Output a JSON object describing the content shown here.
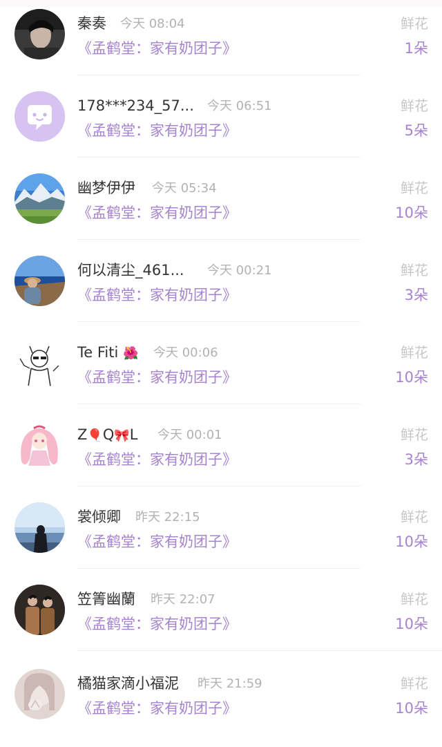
{
  "rows": [
    {
      "name": "秦奏",
      "time": "今天 08:04",
      "book": "《孟鹤堂：家有奶团子》",
      "gift": "鲜花",
      "count": "1朵",
      "avatar": "photo-portrait-dark"
    },
    {
      "name": "178***234_57...",
      "time": "今天 06:51",
      "book": "《孟鹤堂：家有奶团子》",
      "gift": "鲜花",
      "count": "5朵",
      "avatar": "purple-chat-icon"
    },
    {
      "name": "幽梦伊伊",
      "time": "今天 05:34",
      "book": "《孟鹤堂：家有奶团子》",
      "gift": "鲜花",
      "count": "10朵",
      "avatar": "mountain-landscape"
    },
    {
      "name": "何以清尘_461...",
      "time": "今天 00:21",
      "book": "《孟鹤堂：家有奶团子》",
      "gift": "鲜花",
      "count": "3朵",
      "avatar": "seaside-person"
    },
    {
      "name": "Te Fiti",
      "name_emoji": "🌺",
      "time": "今天 00:06",
      "book": "《孟鹤堂：家有奶团子》",
      "gift": "鲜花",
      "count": "10朵",
      "avatar": "sketch-character"
    },
    {
      "name": "Z",
      "name_emoji": "🎈",
      "name_mid": "Q",
      "name_emoji2": "🎀",
      "name_end": "L",
      "time": "今天 00:01",
      "book": "《孟鹤堂：家有奶团子》",
      "gift": "鲜花",
      "count": "3朵",
      "avatar": "anime-pink-girl"
    },
    {
      "name": "裳倾卿",
      "time": "昨天 22:15",
      "book": "《孟鹤堂：家有奶团子》",
      "gift": "鲜花",
      "count": "10朵",
      "avatar": "sky-silhouette"
    },
    {
      "name": "笠箐幽蘭",
      "time": "昨天 22:07",
      "book": "《孟鹤堂：家有奶团子》",
      "gift": "鲜花",
      "count": "10朵",
      "avatar": "two-people-photo"
    },
    {
      "name": "橘猫家滴小福泥",
      "time": "昨天 21:59",
      "book": "《孟鹤堂：家有奶团子》",
      "gift": "鲜花",
      "count": "10朵",
      "avatar": "pale-hand-portrait"
    }
  ],
  "colors": {
    "accent": "#a683d0",
    "name": "#333333",
    "time": "#b2b2b2",
    "gift": "#c7c7c7"
  }
}
